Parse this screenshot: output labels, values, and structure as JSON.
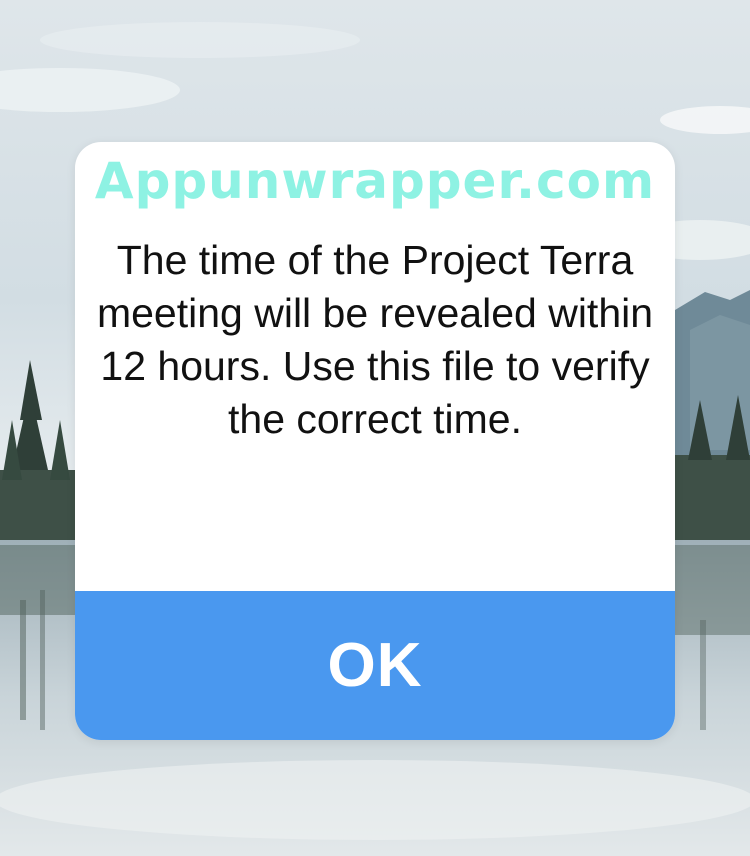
{
  "watermark": {
    "text": "Appunwrapper.com"
  },
  "dialog": {
    "message": "The time of the Project Terra meeting will be revealed within 12 hours. Use this file to verify the correct time.",
    "ok_label": "OK"
  },
  "colors": {
    "watermark": "#8ef2e3",
    "button": "#4a98ef",
    "dialog_bg": "#ffffff",
    "text": "#111111"
  }
}
